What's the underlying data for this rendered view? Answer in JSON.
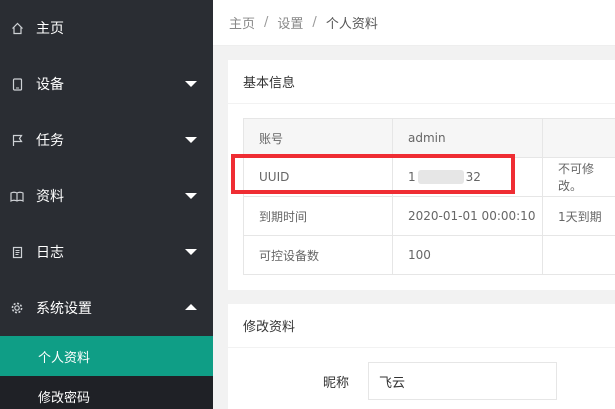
{
  "sidebar": {
    "items": [
      {
        "label": "主页",
        "icon": "home-icon"
      },
      {
        "label": "设备",
        "icon": "tablet-icon"
      },
      {
        "label": "任务",
        "icon": "flag-icon"
      },
      {
        "label": "资料",
        "icon": "book-icon"
      },
      {
        "label": "日志",
        "icon": "log-icon"
      },
      {
        "label": "系统设置",
        "icon": "gear-icon"
      }
    ],
    "sub_items": [
      {
        "label": "个人资料",
        "active": true
      },
      {
        "label": "修改密码",
        "active": false
      }
    ],
    "active_color": "#0f9e86"
  },
  "breadcrumb": {
    "home": "主页",
    "settings": "设置",
    "current": "个人资料"
  },
  "basic_info": {
    "title": "基本信息",
    "rows": [
      {
        "label": "账号",
        "value": "admin",
        "note": ""
      },
      {
        "label": "UUID",
        "value_start": "1",
        "value_end": "32",
        "note": "不可修改。"
      },
      {
        "label": "到期时间",
        "value": "2020-01-01 00:00:10",
        "note": "1天到期"
      },
      {
        "label": "可控设备数",
        "value": "100",
        "note": ""
      }
    ],
    "highlight_color": "#ef2d33"
  },
  "edit_profile": {
    "title": "修改资料",
    "nickname_label": "昵称",
    "nickname_value": "飞云"
  }
}
